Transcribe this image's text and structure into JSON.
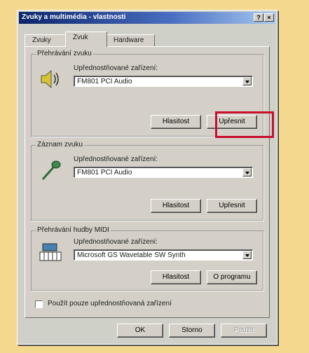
{
  "window": {
    "title": "Zvuky a multimédia - vlastnosti",
    "help_button": "?",
    "close_button": "×"
  },
  "tabs": [
    "Zvuky",
    "Zvuk",
    "Hardware"
  ],
  "groups": {
    "playback": {
      "label": "Přehrávání zvuku",
      "device_label": "Upřednostňované zařízení:",
      "device_value": "FM801 PCI Audio",
      "volume_button": "Hlasitost",
      "advanced_button": "Upřesnit"
    },
    "recording": {
      "label": "Záznam zvuku",
      "device_label": "Upřednostňované zařízení:",
      "device_value": "FM801 PCI Audio",
      "volume_button": "Hlasitost",
      "advanced_button": "Upřesnit"
    },
    "midi": {
      "label": "Přehrávání hudby MIDI",
      "device_label": "Upřednostňované zařízení:",
      "device_value": "Microsoft GS Wavetable SW Synth",
      "volume_button": "Hlasitost",
      "about_button": "O programu"
    }
  },
  "checkbox": {
    "label": "Použít pouze upřednostňovaná zařízení",
    "checked": false
  },
  "footer": {
    "ok": "OK",
    "cancel": "Storno",
    "apply": "Použít"
  },
  "colors": {
    "background": "#f3d88d",
    "highlight": "#c8102e",
    "titlebar": "#0a246a"
  }
}
